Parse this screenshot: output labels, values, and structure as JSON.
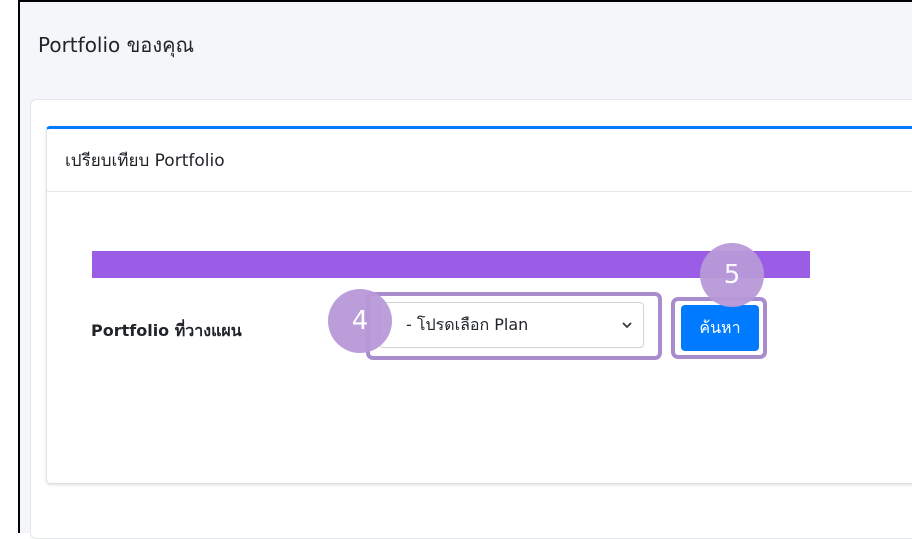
{
  "page": {
    "title": "Portfolio ของคุณ"
  },
  "card": {
    "title": "เปรียบเทียบ Portfolio"
  },
  "form": {
    "label": "Portfolio ที่วางแผน",
    "select_value": "- โปรดเลือก Plan",
    "search_label": "ค้นหา"
  },
  "annotations": {
    "step_4": "4",
    "step_5": "5"
  },
  "colors": {
    "accent": "#007bff",
    "purple_bar": "#9b5de5",
    "highlight": "#a98ccd",
    "badge": "#b899d8"
  },
  "icons": {
    "select_arrow": "chevron-down-icon"
  }
}
